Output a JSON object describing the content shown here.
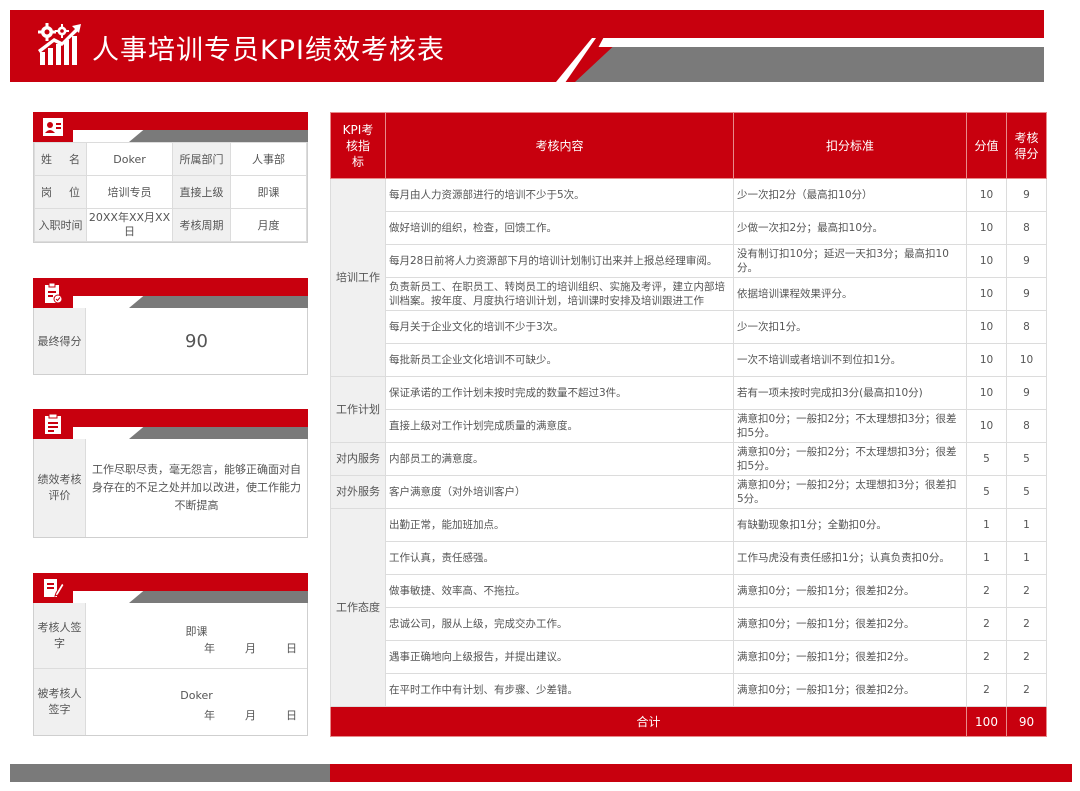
{
  "header": {
    "title": "人事培训专员KPI绩效考核表"
  },
  "info": {
    "rows": [
      {
        "l1": [
          "姓",
          "名"
        ],
        "v1": "Doker",
        "l2": "所属部门",
        "v2": "人事部"
      },
      {
        "l1": [
          "岗",
          "位"
        ],
        "v1": "培训专员",
        "l2": "直接上级",
        "v2": "即课"
      },
      {
        "l1": [
          "入职时间"
        ],
        "v1": "20XX年XX月XX日",
        "l2": "考核周期",
        "v2": "月度"
      }
    ]
  },
  "final_score": {
    "label": "最终得分",
    "value": "90"
  },
  "evaluation": {
    "label": "绩效考核评价",
    "text": "工作尽职尽责，毫无怨言，能够正确面对自身存在的不足之处并加以改进，使工作能力不断提高"
  },
  "signatures": {
    "assessor_label": "考核人签字",
    "assessor_name": "即课",
    "assessee_label": "被考核人签字",
    "assessee_name": "Doker",
    "date_year": "年",
    "date_month": "月",
    "date_day": "日"
  },
  "kpi": {
    "headers": {
      "indicator": "KPI考核指标",
      "content": "考核内容",
      "criteria": "扣分标准",
      "points": "分值",
      "score": "考核得分"
    },
    "groups": [
      {
        "name": "培训工作",
        "rows": [
          {
            "content": "每月由人力资源部进行的培训不少于5次。",
            "criteria": "少一次扣2分（最高扣10分）",
            "points": "10",
            "score": "9"
          },
          {
            "content": "做好培训的组织，检查，回馈工作。",
            "criteria": "少做一次扣2分；最高扣10分。",
            "points": "10",
            "score": "8"
          },
          {
            "content": "每月28日前将人力资源部下月的培训计划制订出来并上报总经理审阅。",
            "criteria": "没有制订扣10分；延迟一天扣3分；最高扣10分。",
            "points": "10",
            "score": "9"
          },
          {
            "content": "负责新员工、在职员工、转岗员工的培训组织、实施及考评，建立内部培训档案。按年度、月度执行培训计划，培训课时安排及培训跟进工作",
            "criteria": "依据培训课程效果评分。",
            "points": "10",
            "score": "9"
          },
          {
            "content": "每月关于企业文化的培训不少于3次。",
            "criteria": "少一次扣1分。",
            "points": "10",
            "score": "8"
          },
          {
            "content": "每批新员工企业文化培训不可缺少。",
            "criteria": "一次不培训或者培训不到位扣1分。",
            "points": "10",
            "score": "10"
          }
        ]
      },
      {
        "name": "工作计划",
        "rows": [
          {
            "content": "保证承诺的工作计划未按时完成的数量不超过3件。",
            "criteria": "若有一项未按时完成扣3分(最高扣10分)",
            "points": "10",
            "score": "9"
          },
          {
            "content": "直接上级对工作计划完成质量的满意度。",
            "criteria": "满意扣0分；一般扣2分；不太理想扣3分；很差扣5分。",
            "points": "10",
            "score": "8"
          }
        ]
      },
      {
        "name": "对内服务",
        "rows": [
          {
            "content": "内部员工的满意度。",
            "criteria": "满意扣0分；一般扣2分；不太理想扣3分；很差扣5分。",
            "points": "5",
            "score": "5"
          }
        ]
      },
      {
        "name": "对外服务",
        "rows": [
          {
            "content": "客户满意度（对外培训客户）",
            "criteria": "满意扣0分；一般扣2分；太理想扣3分；很差扣5分。",
            "points": "5",
            "score": "5"
          }
        ]
      },
      {
        "name": "工作态度",
        "rows": [
          {
            "content": "出勤正常，能加班加点。",
            "criteria": "有缺勤现象扣1分；全勤扣0分。",
            "points": "1",
            "score": "1"
          },
          {
            "content": "工作认真，责任感强。",
            "criteria": "工作马虎没有责任感扣1分；认真负责扣0分。",
            "points": "1",
            "score": "1"
          },
          {
            "content": "做事敏捷、效率高、不拖拉。",
            "criteria": "满意扣0分；一般扣1分；很差扣2分。",
            "points": "2",
            "score": "2"
          },
          {
            "content": "忠诚公司，服从上级，完成交办工作。",
            "criteria": "满意扣0分；一般扣1分；很差扣2分。",
            "points": "2",
            "score": "2"
          },
          {
            "content": "遇事正确地向上级报告，并提出建议。",
            "criteria": "满意扣0分；一般扣1分；很差扣2分。",
            "points": "2",
            "score": "2"
          },
          {
            "content": "在平时工作中有计划、有步骤、少差错。",
            "criteria": "满意扣0分；一般扣1分；很差扣2分。",
            "points": "2",
            "score": "2"
          }
        ]
      }
    ],
    "total": {
      "label": "合计",
      "points": "100",
      "score": "90"
    }
  },
  "colors": {
    "brand_red": "#c8000e",
    "accent_gray": "#7a7a7a",
    "label_bg": "#f0f0f0"
  },
  "icons": {
    "logo": "gear-chart-icon",
    "info": "user-card-icon",
    "score": "clipboard-check-icon",
    "evaluation": "clipboard-list-icon",
    "signature": "document-pen-icon"
  }
}
